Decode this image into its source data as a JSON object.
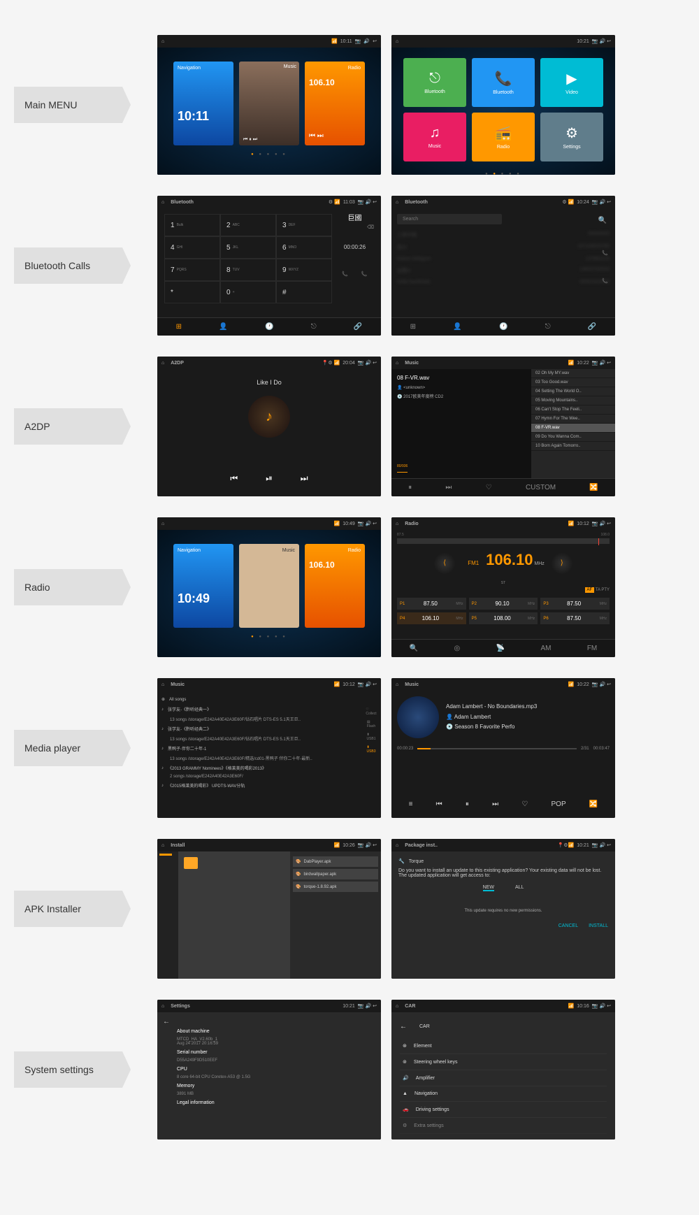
{
  "rows": [
    {
      "label": "Main MENU"
    },
    {
      "label": "Bluetooth Calls"
    },
    {
      "label": "A2DP"
    },
    {
      "label": "Radio"
    },
    {
      "label": "Media player"
    },
    {
      "label": "APK Installer"
    },
    {
      "label": "System settings"
    }
  ],
  "menu1": {
    "time": "10:11",
    "nav": {
      "label": "Navigation",
      "time": "10:11"
    },
    "music": {
      "label": "Music"
    },
    "radio": {
      "label": "Radio",
      "freq": "106.10"
    }
  },
  "menu2": {
    "time": "10:21",
    "tiles": {
      "bt": "Bluetooth",
      "phone": "Bluetooth",
      "video": "Video",
      "music": "Music",
      "radio": "Radio",
      "settings": "Settings"
    }
  },
  "btcall": {
    "title": "Bluetooth",
    "time": "11:03",
    "keys": [
      [
        "1",
        "Bulk"
      ],
      [
        "2",
        "ABC"
      ],
      [
        "3",
        "DEF"
      ],
      [
        "4",
        "GHI"
      ],
      [
        "5",
        "JKL"
      ],
      [
        "6",
        "MNO"
      ],
      [
        "7",
        "PQRS"
      ],
      [
        "8",
        "TUV"
      ],
      [
        "9",
        "WXYZ"
      ],
      [
        "*",
        ""
      ],
      [
        "0",
        "+"
      ],
      [
        "#",
        ""
      ]
    ],
    "display": "巨國",
    "duration": "00:00:26"
  },
  "btlist": {
    "title": "Bluetooth",
    "time": "10:24",
    "search": "Search",
    "contacts": [
      {
        "n": "工事中国",
        "p": "00544593"
      },
      {
        "n": "高兴",
        "p": "137118416760"
      },
      {
        "n": "Katom bekigum",
        "p": "137881124"
      },
      {
        "n": "设置ni",
        "p": "13810742010"
      },
      {
        "n": "India hardshalu",
        "p": "00001924618"
      }
    ]
  },
  "a2dp": {
    "title": "A2DP",
    "time": "20:04",
    "song": "Like I Do"
  },
  "music": {
    "title": "Music",
    "time": "10:22",
    "current": "08 F-VR.wav",
    "artist": "<unknown>",
    "album": "2017欧美年度榜 CD2",
    "position": "80/936",
    "custom": "CUSTOM",
    "tracks": [
      "02 Oh My MY.wav",
      "03 Too Good.wav",
      "04 Setting The World O..",
      "05 Moving Mountains..",
      "06 Can't Stop The Feeli..",
      "07 Hymn For The Wee..",
      "08 F-VR.wav",
      "09 Do You Wanna Com..",
      "10 Born Again Tomorro.."
    ]
  },
  "home2": {
    "time": "10:49",
    "nav_time": "10:49",
    "freq": "106.10"
  },
  "radio": {
    "title": "Radio",
    "time": "10:12",
    "scale": {
      "min": "87.5",
      "max": "108.0"
    },
    "band": "FM1",
    "freq": "106.10",
    "unit": "MHz",
    "st": "ST",
    "af": "AF",
    "ta": "TA",
    "pty": "PTY",
    "presets": [
      {
        "p": "P1",
        "f": "87.50",
        "u": "MHz"
      },
      {
        "p": "P2",
        "f": "90.10",
        "u": "MHz"
      },
      {
        "p": "P3",
        "f": "87.50",
        "u": "MHz"
      },
      {
        "p": "P4",
        "f": "106.10",
        "u": "MHz"
      },
      {
        "p": "P5",
        "f": "108.00",
        "u": "MHz"
      },
      {
        "p": "P6",
        "f": "87.50",
        "u": "MHz"
      }
    ],
    "am": "AM",
    "fm": "FM"
  },
  "medialist": {
    "title": "Music",
    "time": "10:12",
    "all": "All songs",
    "items": [
      {
        "t": "张学友-《黔听经典一》",
        "s": "13 songs /storage/E242A40E42A3E60F/钻石唱片 DTS-ES 5.1天王巨.."
      },
      {
        "t": "张学友-《黔听经典二》",
        "s": "13 songs /storage/E242A40E42A3E60F/钻石唱片 DTS-ES 5.1天王巨.."
      },
      {
        "t": "黑鸭子-伴你二十年-1",
        "s": "13 songs /storage/E242A40E42A3E60F/精选/cd01-黑鸭子 伴你二十年-最新.."
      },
      {
        "t": "《2013 GRAMMY Nominees》《格莱美的喝彩2013》",
        "s": "2 songs /storage/E242A40E42A3E60F/"
      },
      {
        "t": "《2015格莱美的喝彩》 UPDTS-WAV分轨",
        "s": ""
      }
    ],
    "side": [
      "Collect",
      "Flash",
      "USB1",
      "USB3"
    ]
  },
  "player": {
    "title": "Music",
    "time": "10:22",
    "track": "Adam Lambert - No Boundaries.mp3",
    "artist": "Adam Lambert",
    "album": "Season 8 Favorite Perfo",
    "t0": "00:00:23",
    "tc": "2/31",
    "t1": "00:03:47",
    "mode": "POP"
  },
  "apk": {
    "title": "Install",
    "time": "10:26",
    "files": [
      "DabPlayer.apk",
      "birdwallpaper.apk",
      "torque-1.8.92.apk"
    ]
  },
  "pkg": {
    "title": "Package inst..",
    "time": "10:21",
    "app": "Torque",
    "msg": "Do you want to install an update to this existing application? Your existing data will not be lost. The updated application will get access to:",
    "new": "NEW",
    "all": "ALL",
    "perm": "This update requires no new permissions.",
    "cancel": "CANCEL",
    "install": "INSTALL"
  },
  "settings": {
    "title": "Settings",
    "time": "10:21",
    "sections": [
      {
        "l": "About machine",
        "v": "MTCD_HA_V2.60b_1\nAug 24 2017 20:16:59"
      },
      {
        "l": "Serial number",
        "v": "D55A249F9D510EEF"
      },
      {
        "l": "CPU",
        "v": "8 core 64-bit CPU Coretex-A53 @ 1.5G"
      },
      {
        "l": "Memory",
        "v": "3891 MB"
      },
      {
        "l": "Legal information",
        "v": ""
      }
    ]
  },
  "car": {
    "title": "CAR",
    "time": "10:16",
    "head": "CAR",
    "items": [
      "Element",
      "Steering wheel keys",
      "Amplifier",
      "Navigation",
      "Driving settings",
      "Extra settings"
    ]
  }
}
